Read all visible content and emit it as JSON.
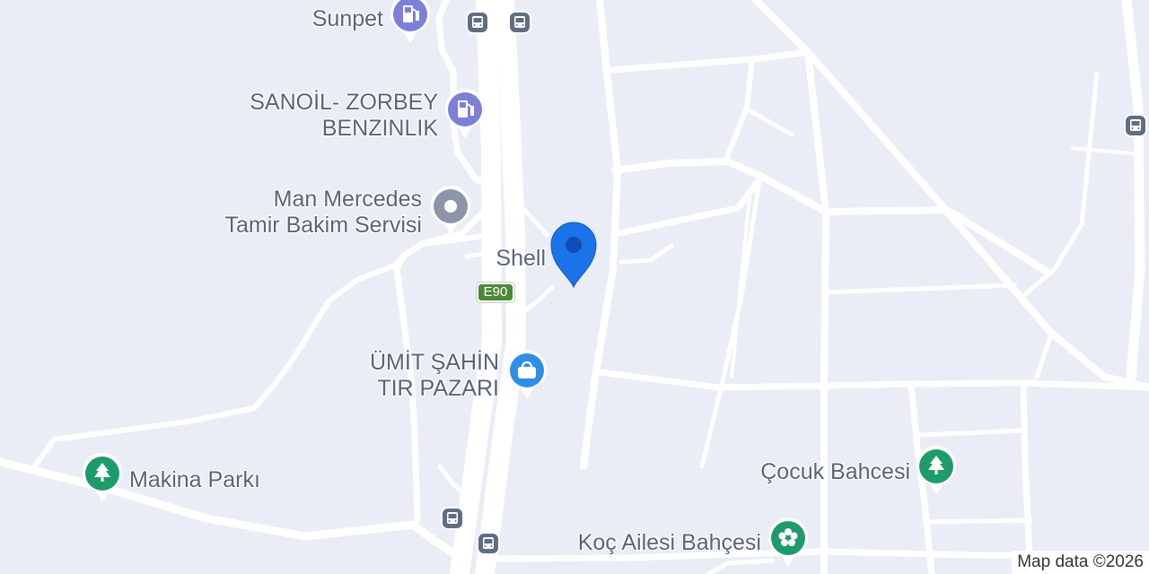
{
  "map": {
    "places": [
      {
        "id": "sunpet",
        "label": "Sunpet",
        "icon": "fuel-icon",
        "color": "#7c80d9"
      },
      {
        "id": "sanoil",
        "label_lines": [
          "SANOİL- ZORBEY",
          "BENZINLIK"
        ],
        "icon": "fuel-icon",
        "color": "#7c80d9"
      },
      {
        "id": "man-mercedes",
        "label_lines": [
          "Man Mercedes",
          "Tamir Bakim Servisi"
        ],
        "icon": "generic-place-icon",
        "color": "#8c96a8"
      },
      {
        "id": "shell",
        "label": "Shell"
      },
      {
        "id": "umit-sahin",
        "label_lines": [
          "ÜMİT ŞAHİN",
          "TIR PAZARI"
        ],
        "icon": "shopping-bag-icon",
        "color": "#2f8fe6"
      },
      {
        "id": "makina-parki",
        "label": "Makina Parkı",
        "icon": "tree-icon",
        "color": "#1e9b6b"
      },
      {
        "id": "cocuk-bahcesi",
        "label": "Çocuk Bahcesi",
        "icon": "tree-icon",
        "color": "#1e9b6b"
      },
      {
        "id": "koc-ailesi",
        "label": "Koç Ailesi Bahçesi",
        "icon": "flower-icon",
        "color": "#1e9b6b"
      }
    ],
    "road_shield": "E90",
    "selected_marker": {
      "icon": "location-pin-icon",
      "color": "#1a73e8"
    },
    "bus_stop_icon": "bus-icon",
    "attribution": "Map data ©2026"
  }
}
